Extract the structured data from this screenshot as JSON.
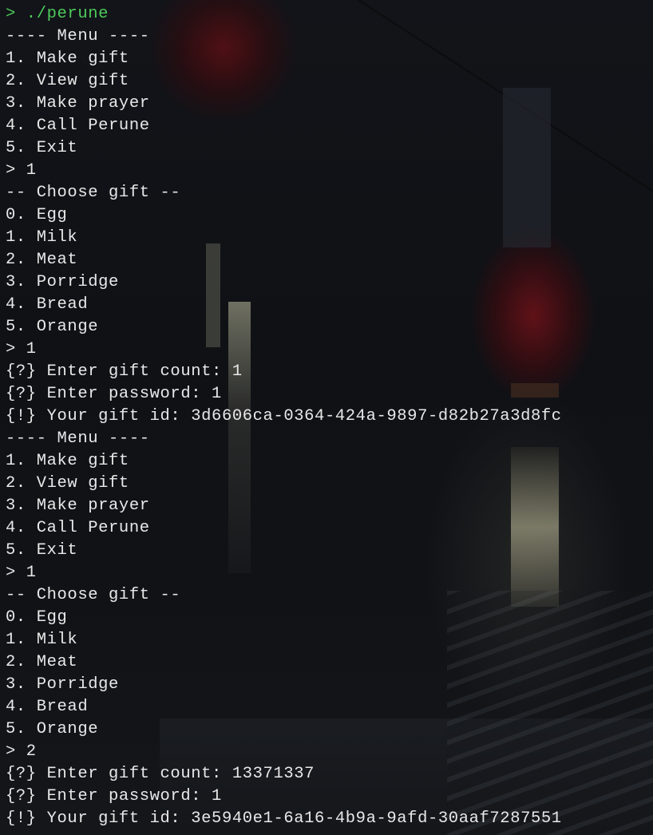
{
  "terminal": {
    "colors": {
      "background": "#0f1115",
      "text": "#e8e8e8",
      "prompt": "#4ec95a"
    },
    "lines": [
      {
        "kind": "prompt",
        "text": "> ./perune"
      },
      {
        "kind": "output",
        "text": "---- Menu ----"
      },
      {
        "kind": "output",
        "text": "1. Make gift"
      },
      {
        "kind": "output",
        "text": "2. View gift"
      },
      {
        "kind": "output",
        "text": "3. Make prayer"
      },
      {
        "kind": "output",
        "text": "4. Call Perune"
      },
      {
        "kind": "output",
        "text": "5. Exit"
      },
      {
        "kind": "input",
        "text": "> 1"
      },
      {
        "kind": "output",
        "text": "-- Choose gift --"
      },
      {
        "kind": "output",
        "text": "0. Egg"
      },
      {
        "kind": "output",
        "text": "1. Milk"
      },
      {
        "kind": "output",
        "text": "2. Meat"
      },
      {
        "kind": "output",
        "text": "3. Porridge"
      },
      {
        "kind": "output",
        "text": "4. Bread"
      },
      {
        "kind": "output",
        "text": "5. Orange"
      },
      {
        "kind": "input",
        "text": "> 1"
      },
      {
        "kind": "output",
        "text": "{?} Enter gift count: 1"
      },
      {
        "kind": "output",
        "text": "{?} Enter password: 1"
      },
      {
        "kind": "output",
        "text": "{!} Your gift id: 3d6606ca-0364-424a-9897-d82b27a3d8fc"
      },
      {
        "kind": "output",
        "text": "---- Menu ----"
      },
      {
        "kind": "output",
        "text": "1. Make gift"
      },
      {
        "kind": "output",
        "text": "2. View gift"
      },
      {
        "kind": "output",
        "text": "3. Make prayer"
      },
      {
        "kind": "output",
        "text": "4. Call Perune"
      },
      {
        "kind": "output",
        "text": "5. Exit"
      },
      {
        "kind": "input",
        "text": "> 1"
      },
      {
        "kind": "output",
        "text": "-- Choose gift --"
      },
      {
        "kind": "output",
        "text": "0. Egg"
      },
      {
        "kind": "output",
        "text": "1. Milk"
      },
      {
        "kind": "output",
        "text": "2. Meat"
      },
      {
        "kind": "output",
        "text": "3. Porridge"
      },
      {
        "kind": "output",
        "text": "4. Bread"
      },
      {
        "kind": "output",
        "text": "5. Orange"
      },
      {
        "kind": "input",
        "text": "> 2"
      },
      {
        "kind": "output",
        "text": "{?} Enter gift count: 13371337"
      },
      {
        "kind": "output",
        "text": "{?} Enter password: 1"
      },
      {
        "kind": "output",
        "text": "{!} Your gift id: 3e5940e1-6a16-4b9a-9afd-30aaf7287551"
      }
    ]
  }
}
